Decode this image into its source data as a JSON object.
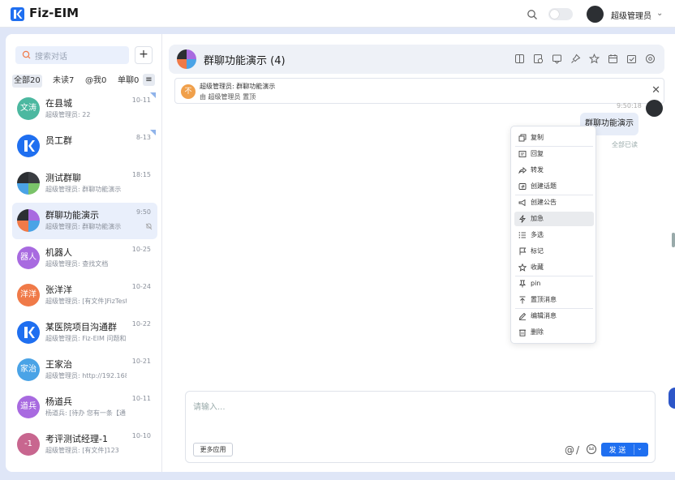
{
  "app": {
    "title": "Fiz-EIM",
    "brand_color": "#1f6ff0"
  },
  "topbar": {
    "user_name": "超级管理员",
    "chevron": "⌄"
  },
  "sidebar": {
    "search_placeholder": "搜索对话",
    "add_label": "+",
    "filters": [
      {
        "label": "全部20",
        "active": true
      },
      {
        "label": "未读7",
        "active": false
      },
      {
        "label": "@我0",
        "active": false
      },
      {
        "label": "单聊0",
        "active": false
      }
    ],
    "filter_menu_icon": "≡",
    "conversations": [
      {
        "name": "在县城",
        "last": "超级管理员: 22",
        "time": "10-11",
        "avatar_text": "文涛",
        "avatar_color": "#4cb8a0",
        "corner": true
      },
      {
        "name": "员工群",
        "last": "",
        "time": "8-13",
        "avatar_text": "",
        "avatar_color": "#1f6ff0",
        "corner": true,
        "logo": true
      },
      {
        "name": "测试群聊",
        "last": "超级管理员: 群聊功能演示",
        "time": "18:15",
        "avatar_color": "#333",
        "grid": true
      },
      {
        "name": "群聊功能演示",
        "last": "超级管理员: 群聊功能演示",
        "time": "9:50",
        "avatar_color": "#333",
        "grid": true,
        "active": true,
        "muted": true
      },
      {
        "name": "机器人",
        "last": "超级管理员: 查找文档",
        "time": "10-25",
        "avatar_text": "器人",
        "avatar_color": "#a86ae0"
      },
      {
        "name": "张洋洋",
        "last": "超级管理员: [有文件]FizTest",
        "time": "10-24",
        "avatar_text": "洋洋",
        "avatar_color": "#f07a48"
      },
      {
        "name": "某医院项目沟通群",
        "last": "超级管理员: Fiz-EIM 问题和",
        "time": "10-22",
        "avatar_text": "",
        "avatar_color": "#1f6ff0",
        "logo": true
      },
      {
        "name": "王家治",
        "last": "超级管理员: http://192.168",
        "time": "10-21",
        "avatar_text": "家治",
        "avatar_color": "#4aa3e6"
      },
      {
        "name": "杨道兵",
        "last": "杨道兵: [待办 您有一条【通",
        "time": "10-11",
        "avatar_text": "道兵",
        "avatar_color": "#a86ae0"
      },
      {
        "name": "考评测试经理-1",
        "last": "超级管理员: [有文件]123",
        "time": "10-10",
        "avatar_text": "-1",
        "avatar_color": "#c8668f"
      }
    ]
  },
  "chat": {
    "title": "群聊功能演示 (4)",
    "header_icons": [
      "split-view-icon",
      "history-icon",
      "announcement-icon",
      "pin-icon",
      "star-icon",
      "calendar-icon",
      "tasks-icon",
      "settings-icon"
    ],
    "pinned": {
      "avatar_text": "不",
      "line1": "超级管理员: 群聊功能演示",
      "line2": "由 超级管理员 置顶",
      "close": "✕"
    },
    "message": {
      "time": "9:50:18",
      "text": "群聊功能演示",
      "status": "全部已读"
    },
    "context_menu": [
      {
        "label": "复制",
        "icon": "copy-icon"
      },
      {
        "label": "回复",
        "icon": "reply-icon"
      },
      {
        "label": "转发",
        "icon": "forward-icon"
      },
      {
        "label": "创建话题",
        "icon": "topic-icon"
      },
      {
        "label": "创建公告",
        "icon": "megaphone-icon"
      },
      {
        "label": "加急",
        "icon": "lightning-icon",
        "highlighted": true
      },
      {
        "label": "多选",
        "icon": "multiselect-icon"
      },
      {
        "label": "标记",
        "icon": "flag-icon"
      },
      {
        "label": "收藏",
        "icon": "star-icon"
      },
      {
        "label": "pin",
        "icon": "pin-icon"
      },
      {
        "label": "置顶消息",
        "icon": "pin-top-icon"
      },
      {
        "label": "编辑消息",
        "icon": "edit-icon"
      },
      {
        "label": "删除",
        "icon": "trash-icon"
      }
    ],
    "input": {
      "placeholder": "请输入...",
      "more_apps": "更多应用",
      "at": "@",
      "slash": "/",
      "send": "发 送",
      "send_chevron": "⌄"
    }
  }
}
